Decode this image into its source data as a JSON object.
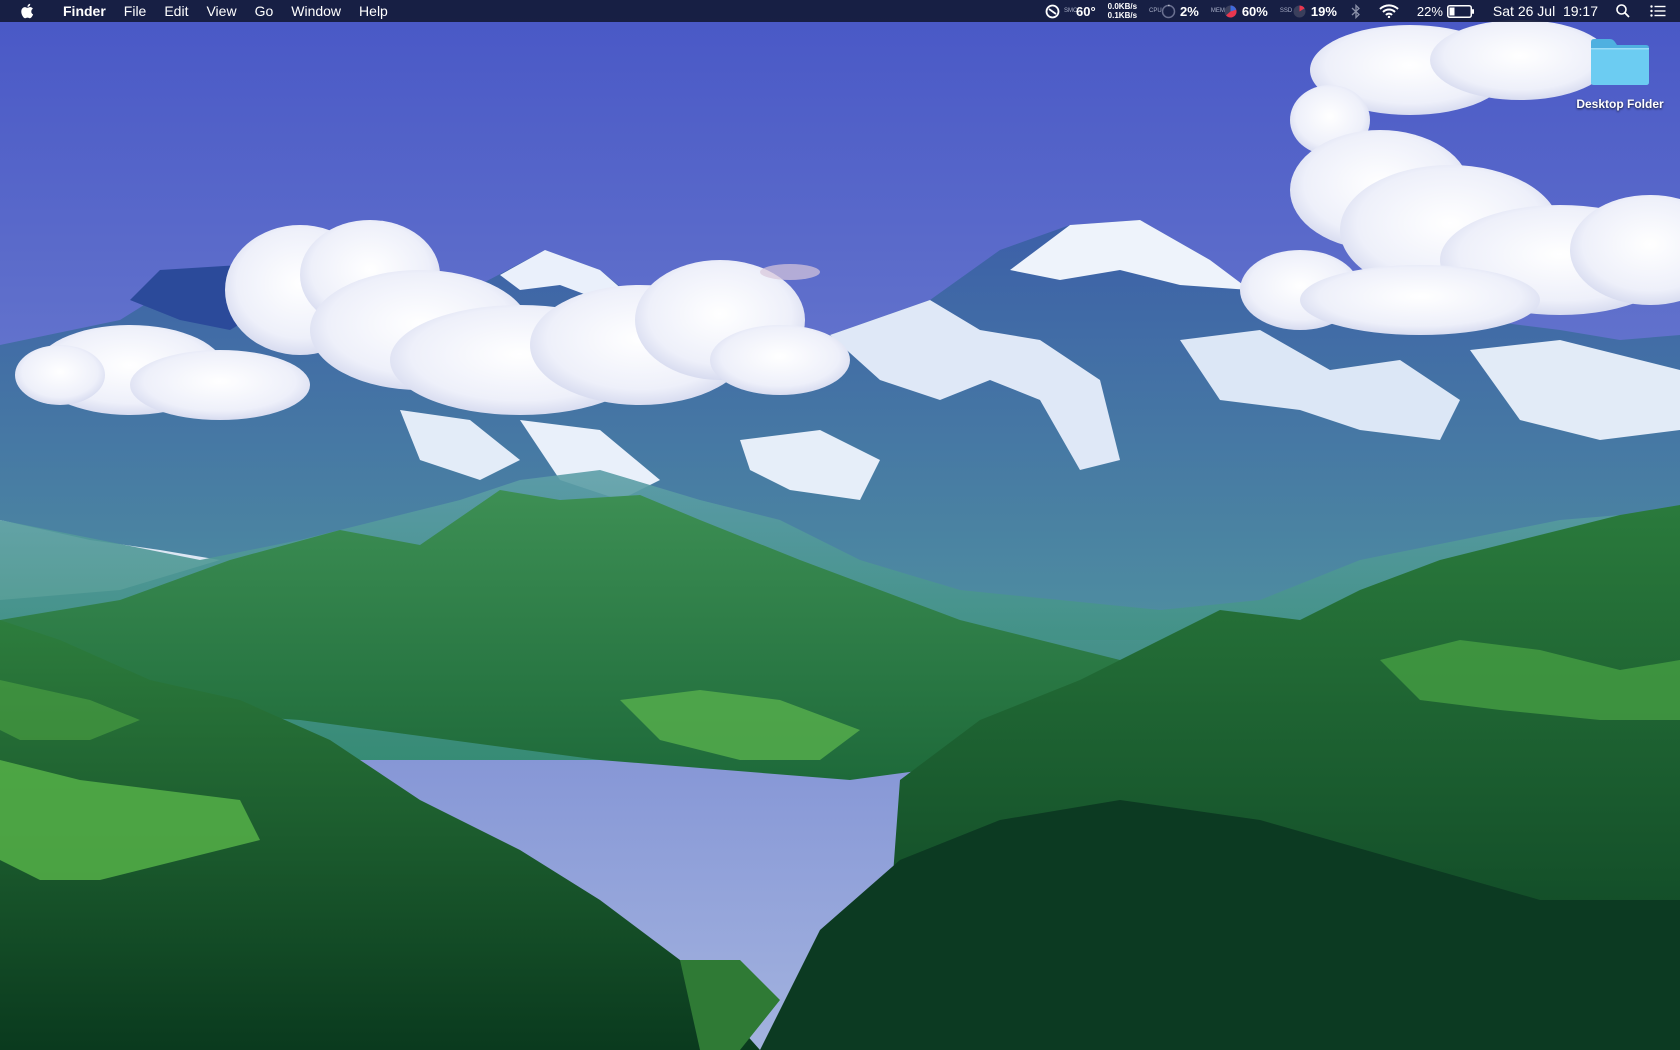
{
  "menubar": {
    "apple_icon": "apple-logo",
    "app_name": "Finder",
    "menus": [
      "File",
      "Edit",
      "View",
      "Go",
      "Window",
      "Help"
    ],
    "status": {
      "cpu_temp": "60°",
      "network_down": "0.0KB/s",
      "network_up": "0.1KB/s",
      "cpu_usage": "2%",
      "memory_usage": "60%",
      "disk_usage": "19%",
      "battery_percent": "22%",
      "datetime": "Sat 26 Jul  19:17"
    },
    "icons": [
      "istat-gauge-icon",
      "cpu-pie-icon",
      "memory-pie-icon",
      "disk-pie-icon",
      "bluetooth-icon",
      "wifi-icon",
      "battery-icon",
      "spotlight-search-icon",
      "notification-center-icon"
    ]
  },
  "desktop": {
    "icons": [
      {
        "label": "Desktop Folder",
        "icon": "folder-icon",
        "color": "#5cc6ee"
      }
    ]
  },
  "colors": {
    "menubar_bg": "#141a38",
    "sky_top": "#4d5fc9",
    "sky_bottom": "#8fa6dc",
    "forest_dark": "#0c3a22",
    "forest_light": "#3e9a3a",
    "snow": "#eef3fb"
  }
}
